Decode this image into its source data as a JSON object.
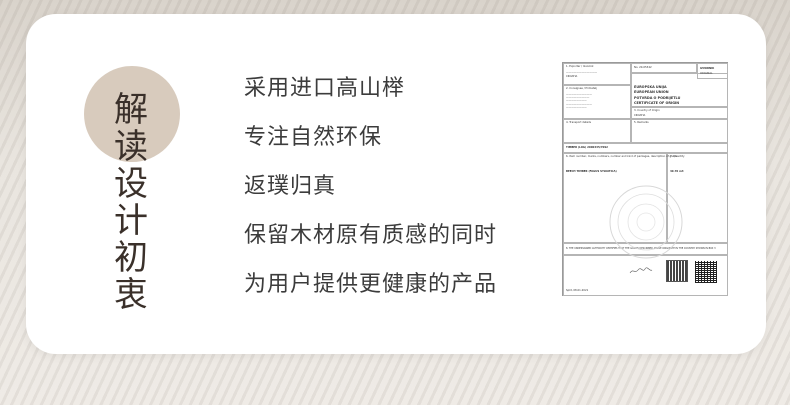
{
  "title_chars": [
    "解",
    "读",
    "设",
    "计",
    "初",
    "衷"
  ],
  "features": [
    "采用进口高山榉",
    "专注自然环保",
    "返璞归真",
    "保留木材原有质感的同时",
    "为用户提供更健康的产品"
  ],
  "certificate": {
    "field_1": "1. Exporter / Izvoznik",
    "original": "IZVORNIK",
    "original_en": "ORIGINAL",
    "number": "No. 20-05342",
    "title_hr": "EUROPSKA UNIJA",
    "title_en": "EUROPEAN UNION",
    "title_cert_hr": "POTVRDA O PODRIJETLU",
    "title_cert_en": "CERTIFICATE OF ORIGIN",
    "country": "CROATIA",
    "field_2": "2. Consignee / Primatelj",
    "field_3": "3. Country of Origin",
    "field_4": "4. Transport details",
    "field_5": "5. Remarks",
    "timber_line": "TIMBER (LOG) 2000435/7092",
    "field_6": "6. Item number, marks, numbers, number and kind of packages, description of goods",
    "field_7": "7. Quantity",
    "goods_line": "BEECH TIMBER (FAGUS SYLVATICA)",
    "qty_line": "40.70 m3",
    "declaration": "8. THE UNDERSIGNED AUTHORITY CERTIFIES THAT THE GOODS DESCRIBED ABOVE ORIGINATE IN THE COUNTRY SHOWN IN BOX 3",
    "place_date": "Split, 08.01.2021"
  }
}
